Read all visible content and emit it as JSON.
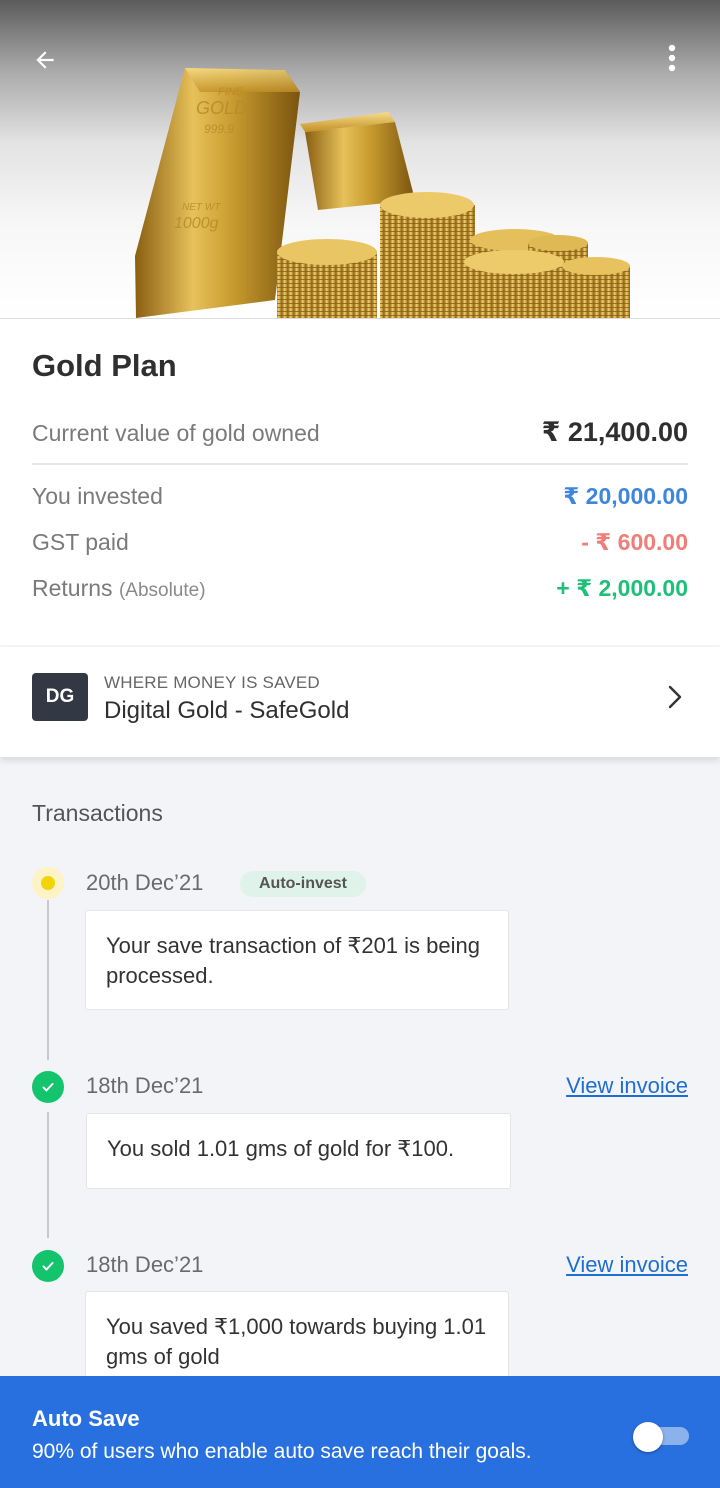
{
  "hero": {
    "bar_text": [
      "FINE",
      "GOLD",
      "999.9",
      "NET WT",
      "1000g"
    ]
  },
  "plan": {
    "title": "Gold Plan",
    "current_value_label": "Current value of gold owned",
    "current_value": "₹ 21,400.00",
    "invested_label": "You invested",
    "invested_value": "₹ 20,000.00",
    "gst_label": "GST paid",
    "gst_value": "- ₹ 600.00",
    "returns_label": "Returns",
    "returns_sub": "(Absolute)",
    "returns_value": "+ ₹ 2,000.00"
  },
  "saved": {
    "badge": "DG",
    "caption": "WHERE MONEY IS SAVED",
    "name": "Digital Gold - SafeGold"
  },
  "transactions": {
    "heading": "Transactions",
    "items": [
      {
        "date": "20th Dec’21",
        "tag": "Auto-invest",
        "status": "pending",
        "message": "Your save transaction of ₹201 is being processed."
      },
      {
        "date": "18th Dec’21",
        "link": "View invoice",
        "status": "done",
        "message": "You sold 1.01 gms of gold for ₹100."
      },
      {
        "date": "18th Dec’21",
        "link": "View invoice",
        "status": "done",
        "message": "You saved ₹1,000 towards buying 1.01 gms of gold"
      }
    ]
  },
  "autosave": {
    "title": "Auto Save",
    "subtitle": "90% of users who enable auto save reach their goals.",
    "enabled": false
  },
  "colors": {
    "invested": "#3d86dc",
    "gst": "#f07e78",
    "returns": "#1fbf7a",
    "link": "#1e6ed2",
    "autosave_bg": "#2870e0"
  },
  "icons": [
    "arrow-back-icon",
    "more-vertical-icon",
    "chevron-right-icon",
    "check-icon"
  ]
}
